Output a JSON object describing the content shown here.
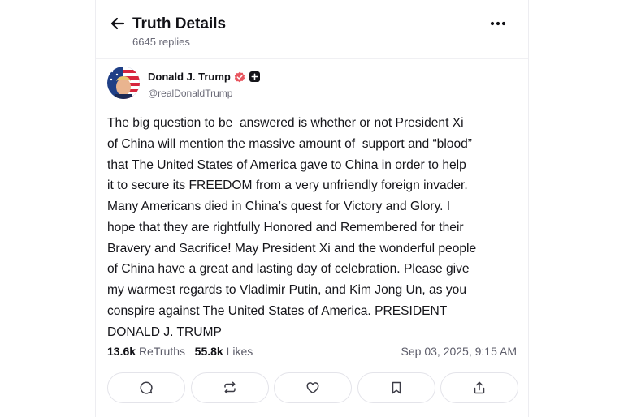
{
  "header": {
    "title": "Truth Details",
    "reply_count": "6645 replies",
    "back_icon": "arrow-left-icon",
    "more_icon": "more-horizontal-icon"
  },
  "author": {
    "display_name": "Donald J. Trump",
    "handle": "@realDonaldTrump",
    "verified_icon": "verified-badge-icon",
    "verified_color": "#e8565f",
    "plus_icon": "plus-badge-icon"
  },
  "post": {
    "text": "The big question to be  answered is whether or not President Xi\nof China will mention the massive amount of  support and “blood”\nthat The United States of America gave to China in order to help\nit to secure its FREEDOM from a very unfriendly foreign invader.\nMany Americans died in China’s quest for Victory and Glory. I\nhope that they are rightfully Honored and Remembered for their\nBravery and Sacrifice! May President Xi and the wonderful people\nof China have a great and lasting day of celebration. Please give\nmy warmest regards to Vladimir Putin, and Kim Jong Un, as you\nconspire against The United States of America. PRESIDENT\nDONALD J. TRUMP"
  },
  "stats": {
    "retruths_count": "13.6k",
    "retruths_label": "ReTruths",
    "likes_count": "55.8k",
    "likes_label": "Likes",
    "timestamp": "Sep 03, 2025, 9:15 AM"
  },
  "actions": [
    {
      "name": "reply",
      "icon": "reply-icon"
    },
    {
      "name": "retruth",
      "icon": "retruth-icon"
    },
    {
      "name": "like",
      "icon": "heart-icon"
    },
    {
      "name": "bookmark",
      "icon": "bookmark-icon"
    },
    {
      "name": "share",
      "icon": "share-icon"
    }
  ]
}
